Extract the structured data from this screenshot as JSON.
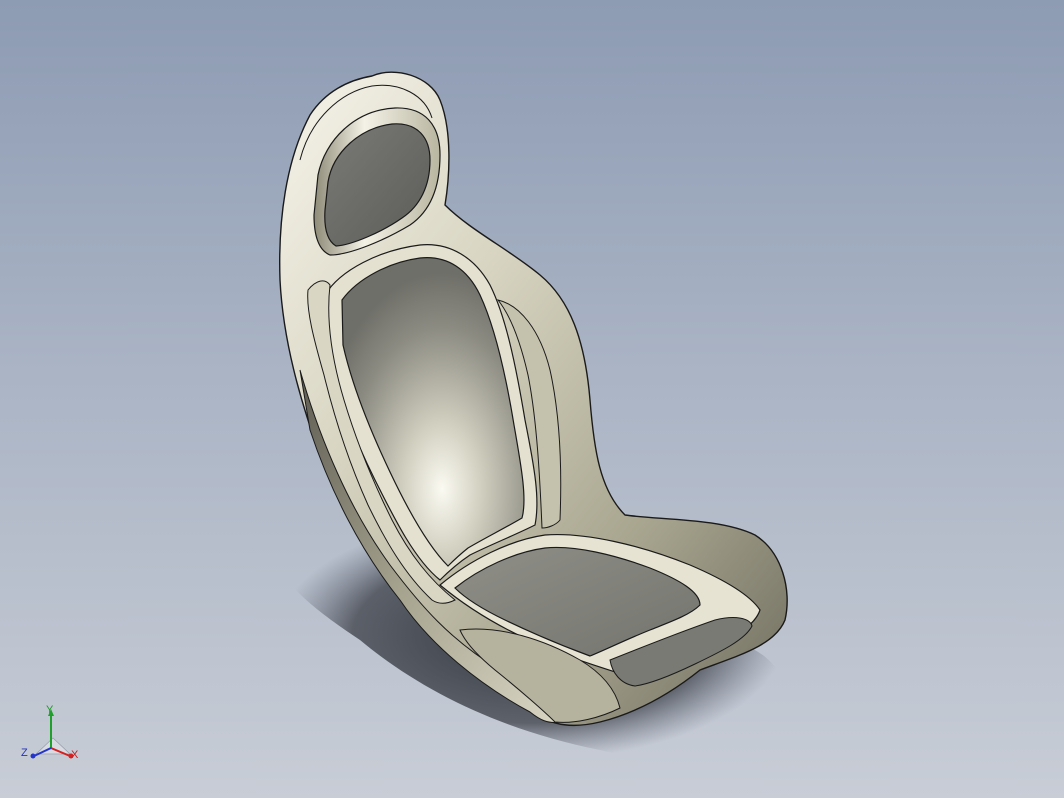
{
  "viewport": {
    "background_top": "#8d9bb3",
    "background_bottom": "#c8cdd6",
    "model": "racing-seat-shell"
  },
  "model_colors": {
    "shell_light": "#f2f0e4",
    "shell_mid": "#c9c6b2",
    "shell_dark": "#6e6c5e",
    "cushion": "#8a8a84",
    "edge": "#1a1a1a",
    "shadow": "#3a3d44"
  },
  "triad": {
    "x_label": "X",
    "y_label": "Y",
    "z_label": "Z",
    "x_color": "#d42020",
    "y_color": "#1fa02a",
    "z_color": "#2434c8"
  }
}
